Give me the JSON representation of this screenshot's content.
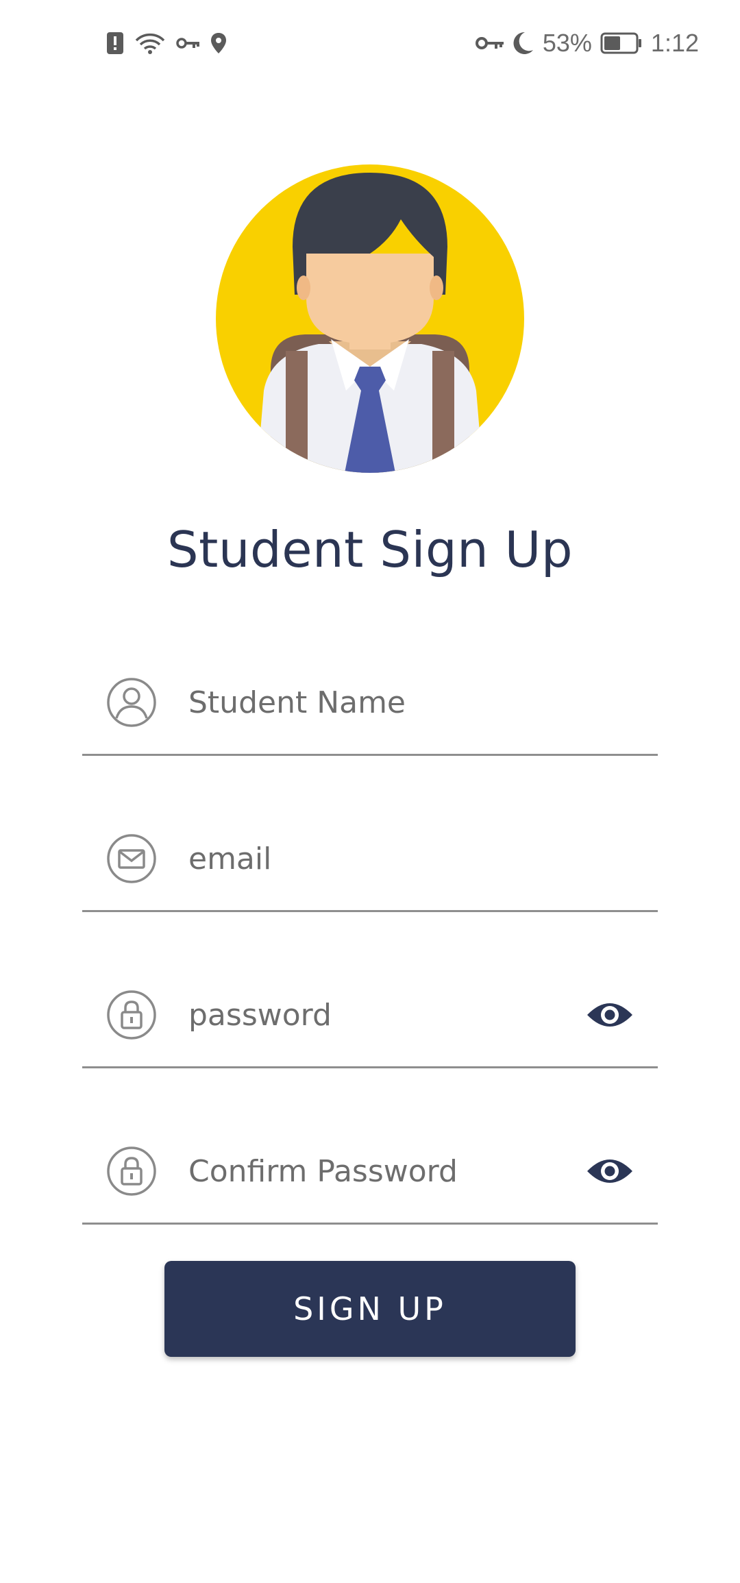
{
  "status_bar": {
    "left_icons": [
      "alert-icon",
      "wifi-icon",
      "vpn-key-icon",
      "location-pin-icon"
    ],
    "right_icons": [
      "vpn-key-icon",
      "do-not-disturb-moon-icon",
      "battery-icon"
    ],
    "battery_percent": "53%",
    "battery_level": 0.53,
    "time": "1:12"
  },
  "avatar": {
    "icon": "student-avatar-icon",
    "colors": {
      "background": "#F9D000",
      "hair": "#3A3F4B",
      "skin": "#F6CB9E",
      "shirt": "#EFF0F5",
      "tie": "#4D5CA9",
      "straps": "#8B6A5C"
    }
  },
  "title": "Student Sign Up",
  "form": {
    "fields": [
      {
        "placeholder": "Student Name",
        "icon": "user-icon",
        "type": "text"
      },
      {
        "placeholder": "email",
        "icon": "envelope-icon",
        "type": "email"
      },
      {
        "placeholder": "password",
        "icon": "lock-icon",
        "type": "password",
        "toggle_icon": "eye-icon"
      },
      {
        "placeholder": "Confirm Password",
        "icon": "lock-icon",
        "type": "password",
        "toggle_icon": "eye-icon"
      }
    ]
  },
  "button": {
    "label": "SIGN UP"
  },
  "colors": {
    "primary": "#2B3656",
    "title": "#2B3553",
    "divider": "#8E8E8E",
    "placeholder": "#6D6D6D"
  }
}
